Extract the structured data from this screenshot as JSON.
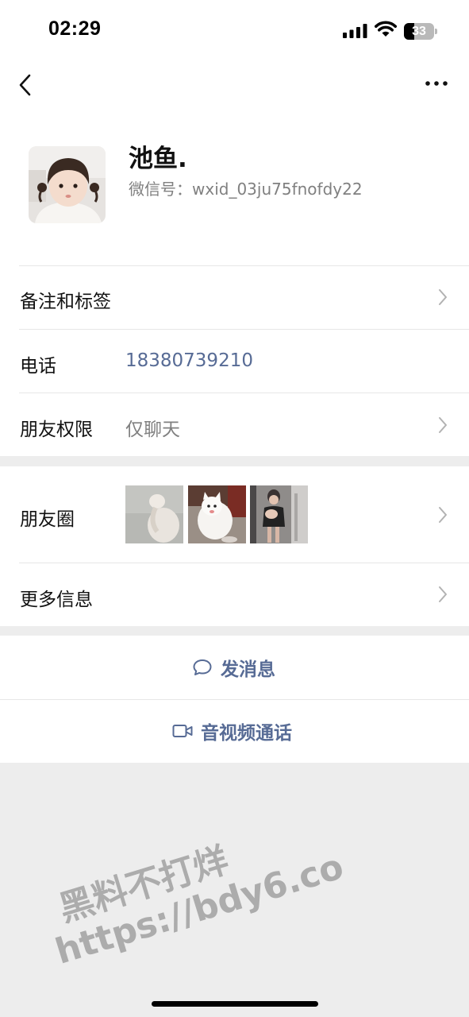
{
  "status_bar": {
    "time": "02:29",
    "battery_level": "33",
    "battery_fraction": 0.33,
    "icons": [
      "cellular-signal-icon",
      "wifi-icon",
      "battery-icon"
    ]
  },
  "nav": {
    "icons": [
      "back-chevron-icon",
      "more-dots-icon"
    ]
  },
  "profile": {
    "display_name": "池鱼.",
    "wechat_id": "微信号：wxid_03ju75fnofdy22"
  },
  "rows": {
    "remarks_tags": {
      "label": "备注和标签"
    },
    "phone": {
      "label": "电话",
      "value": "18380739210"
    },
    "permissions": {
      "label": "朋友权限",
      "value": "仅聊天"
    },
    "moments": {
      "label": "朋友圈",
      "thumbnails": [
        "moments-photo-1",
        "moments-photo-2",
        "moments-photo-3"
      ]
    },
    "more_info": {
      "label": "更多信息"
    }
  },
  "actions": {
    "send_message": "发消息",
    "video_call": "音视频通话"
  },
  "watermark": {
    "line1": "黑料不打烊",
    "line2": "https://bdy6.co"
  },
  "colors": {
    "link_blue": "#576b95",
    "background_gray": "#ededed",
    "secondary_text": "#808080"
  }
}
